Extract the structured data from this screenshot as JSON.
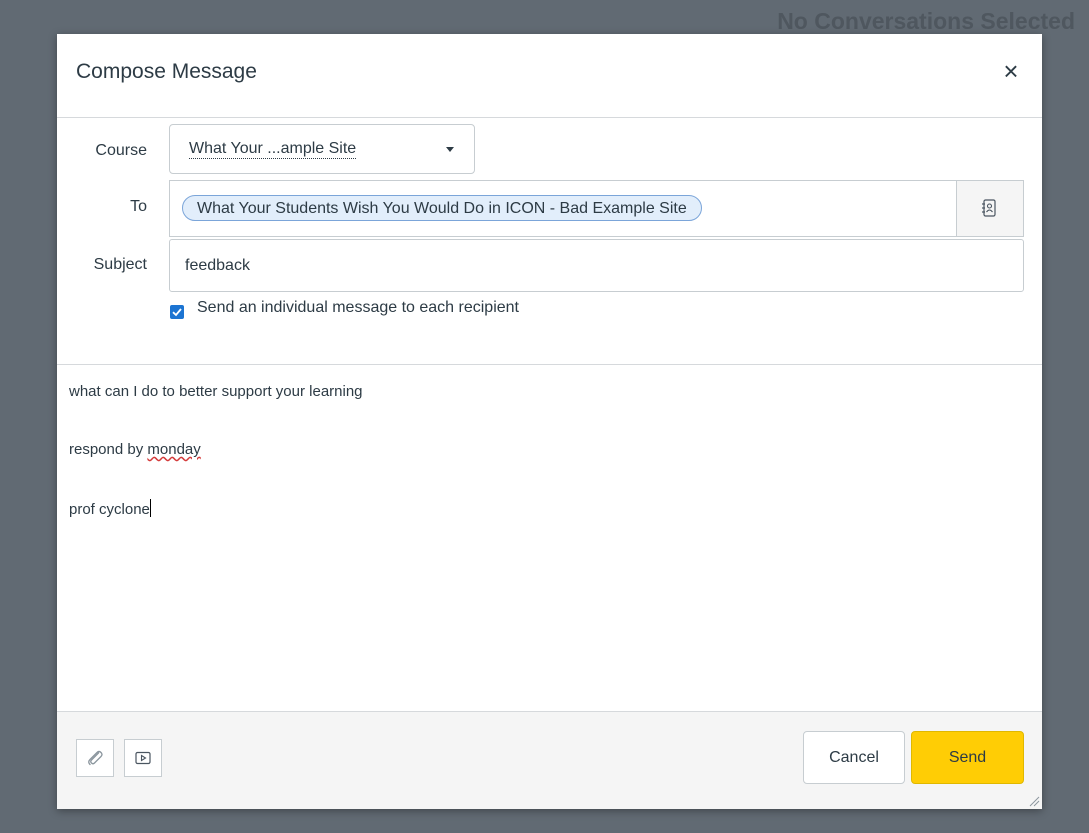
{
  "background": {
    "heading": "No Conversations Selected"
  },
  "dialog": {
    "title": "Compose Message",
    "close_icon": "×"
  },
  "form": {
    "course_label": "Course",
    "course_value": "What Your ...ample Site",
    "to_label": "To",
    "recipient": "What Your Students Wish You Would Do in ICON - Bad Example Site",
    "subject_label": "Subject",
    "subject_value": "feedback",
    "individual_message_label": "Send an individual message to each recipient",
    "individual_message_checked": true
  },
  "message": {
    "line1": "what can I do to better support your learning",
    "line2_prefix": "respond by ",
    "line2_word": "monday",
    "line3": "prof cyclone"
  },
  "footer": {
    "cancel_label": "Cancel",
    "send_label": "Send"
  },
  "icons": {
    "attach": "paperclip-icon",
    "media": "media-play-icon",
    "address_book": "address-book-icon",
    "close": "close-icon"
  },
  "colors": {
    "send_button": "#ffcd05",
    "checkbox": "#1c74d2",
    "backdrop": "#616a73"
  }
}
